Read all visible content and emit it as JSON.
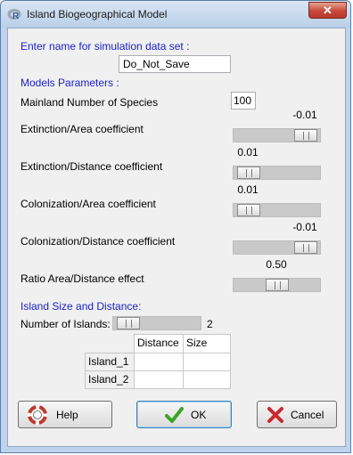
{
  "window": {
    "title": "Island Biogeographical Model",
    "close_glyph": "✕"
  },
  "sim_name": {
    "label": "Enter name for simulation data set :",
    "value": "Do_Not_Save"
  },
  "models": {
    "header": "Models Parameters :"
  },
  "mainland": {
    "label": "Mainland Number of Species",
    "value": "100"
  },
  "sliders": [
    {
      "label": "Extinction/Area coefficient",
      "value": "-0.01",
      "position": 0.96
    },
    {
      "label": "Extinction/Distance coefficient",
      "value": "0.01",
      "position": 0.06
    },
    {
      "label": "Colonization/Area coefficient",
      "value": "0.01",
      "position": 0.06
    },
    {
      "label": "Colonization/Distance coefficient",
      "value": "-0.01",
      "position": 0.96
    },
    {
      "label": "Ratio Area/Distance effect",
      "value": "0.50",
      "position": 0.5
    }
  ],
  "islands": {
    "header": "Island Size and Distance:",
    "count_label": "Number of Islands:",
    "count_value": "2",
    "count_position": 0.06,
    "columns": [
      "Distance",
      "Size"
    ],
    "rows": [
      {
        "name": "Island_1",
        "distance": "",
        "size": ""
      },
      {
        "name": "Island_2",
        "distance": "",
        "size": ""
      }
    ]
  },
  "buttons": {
    "help": "Help",
    "ok": "OK",
    "cancel": "Cancel"
  },
  "colors": {
    "accent_text": "#1a23c8",
    "ok_check": "#3fa32a",
    "cancel_x": "#c8282e"
  }
}
